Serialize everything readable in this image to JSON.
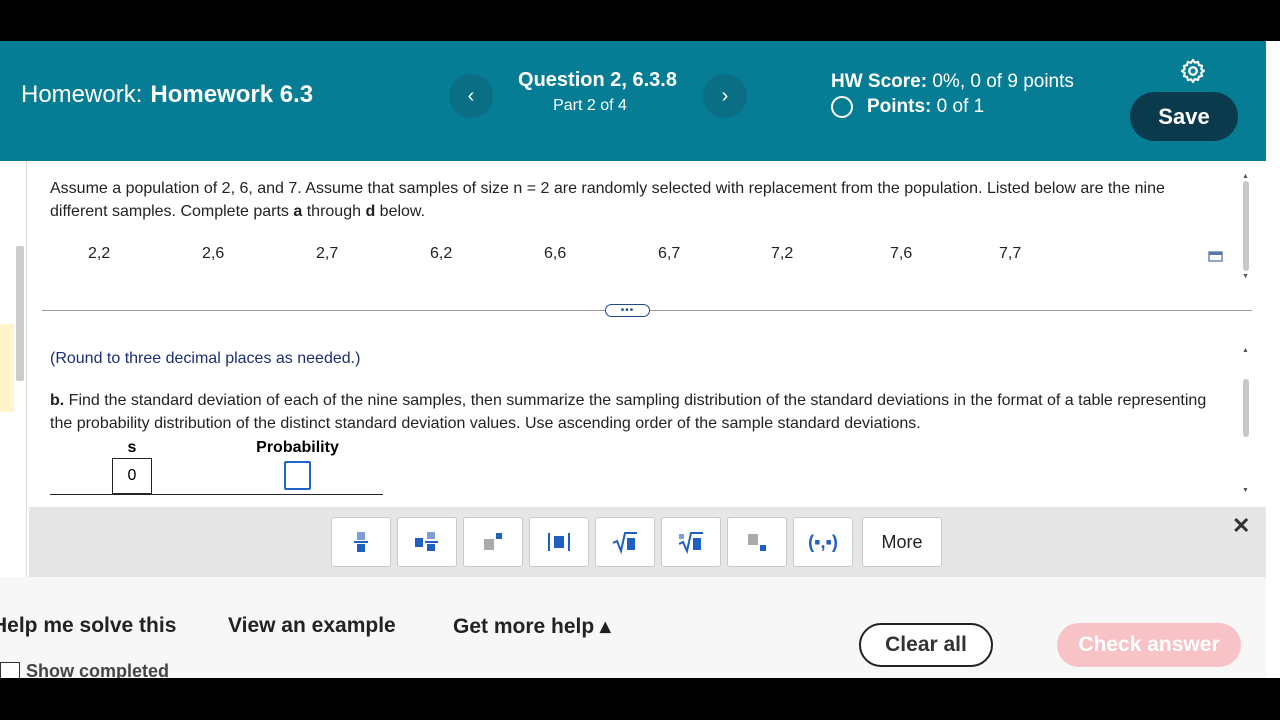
{
  "header": {
    "homework_label": "Homework:",
    "homework_name": "Homework 6.3",
    "prev_icon": "‹",
    "next_icon": "›",
    "question_title": "Question 2, 6.3.8",
    "question_part": "Part 2 of 4",
    "hw_score_label": "HW Score:",
    "hw_score_value": "0%, 0 of 9 points",
    "points_label": "Points:",
    "points_value": "0 of 1",
    "save_label": "Save",
    "colors": {
      "bar": "#067d94",
      "save": "#0b3a4d"
    }
  },
  "question": {
    "text_before_a": "Assume a population of 2, 6, and 7. Assume that samples of size n = 2 are randomly selected with replacement from the population. Listed below are the nine different samples. Complete parts ",
    "part_a": "a",
    "through": " through ",
    "part_d": "d",
    "text_end": " below.",
    "samples": [
      "2,2",
      "2,6",
      "2,7",
      "6,2",
      "6,6",
      "6,7",
      "7,2",
      "7,6",
      "7,7"
    ]
  },
  "work_area": {
    "round_note": "(Round to three decimal places as needed.)",
    "part_b_label": "b.",
    "part_b_text": " Find the standard deviation of each of the nine samples, then summarize the sampling distribution of the standard deviations in the format of a table representing the probability distribution of the distinct standard deviation values. Use ascending order of the sample standard deviations.",
    "col_s": "s",
    "col_probability": "Probability",
    "s_value": "0",
    "probability_value": ""
  },
  "toolbar": {
    "tools": [
      "fraction",
      "mixed-number",
      "exponent",
      "absolute-value",
      "square-root",
      "nth-root",
      "subscript",
      "ordered-pair"
    ],
    "ordered_pair_label": "(▪,▪)",
    "more_label": "More",
    "close_label": "✕"
  },
  "footer": {
    "help_solve": "Help me solve this",
    "view_example": "View an example",
    "get_more_help": "Get more help ▴",
    "show_completed": "Show completed",
    "clear_all": "Clear all",
    "check_answer": "Check answer",
    "colors": {
      "check_answer_bg": "#f7c3c7"
    }
  }
}
